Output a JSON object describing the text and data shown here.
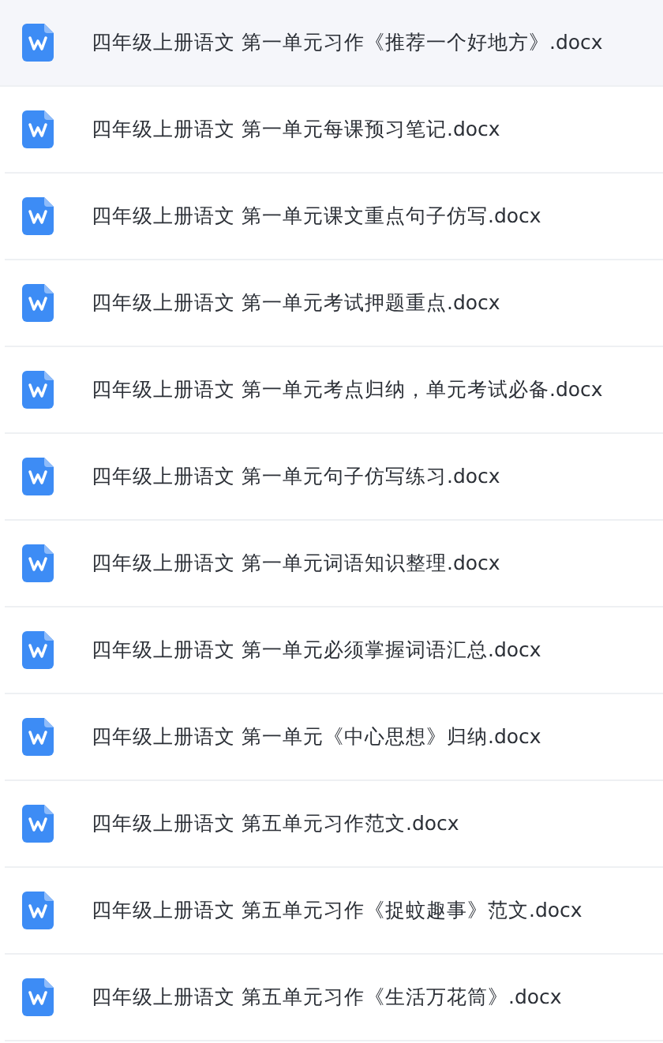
{
  "files": [
    {
      "name": "四年级上册语文 第一单元习作《推荐一个好地方》.docx",
      "selected": true
    },
    {
      "name": "四年级上册语文 第一单元每课预习笔记.docx",
      "selected": false
    },
    {
      "name": "四年级上册语文 第一单元课文重点句子仿写.docx",
      "selected": false
    },
    {
      "name": "四年级上册语文 第一单元考试押题重点.docx",
      "selected": false
    },
    {
      "name": "四年级上册语文 第一单元考点归纳，单元考试必备.docx",
      "selected": false
    },
    {
      "name": "四年级上册语文 第一单元句子仿写练习.docx",
      "selected": false
    },
    {
      "name": "四年级上册语文 第一单元词语知识整理.docx",
      "selected": false
    },
    {
      "name": "四年级上册语文 第一单元必须掌握词语汇总.docx",
      "selected": false
    },
    {
      "name": "四年级上册语文 第一单元《中心思想》归纳.docx",
      "selected": false
    },
    {
      "name": "四年级上册语文 第五单元习作范文.docx",
      "selected": false
    },
    {
      "name": "四年级上册语文 第五单元习作《捉蚊趣事》范文.docx",
      "selected": false
    },
    {
      "name": "四年级上册语文 第五单元习作《生活万花筒》.docx",
      "selected": false
    }
  ]
}
